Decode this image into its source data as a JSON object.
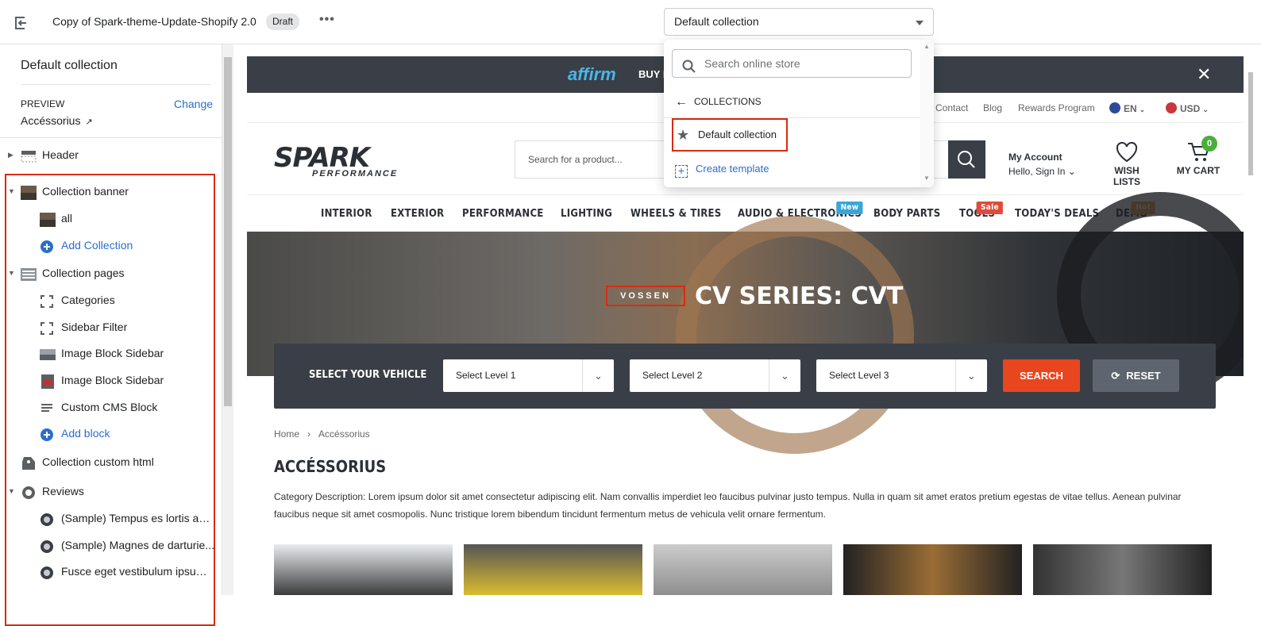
{
  "topbar": {
    "theme_name": "Copy of Spark-theme-Update-Shopify 2.0",
    "status_badge": "Draft",
    "more_label": "•••",
    "template_select": "Default collection"
  },
  "dropdown": {
    "search_placeholder": "Search online store",
    "back_label": "COLLECTIONS",
    "items": [
      "Default collection"
    ],
    "create_label": "Create template"
  },
  "sidebar": {
    "title": "Default collection",
    "preview_label": "PREVIEW",
    "change_label": "Change",
    "preview_value": "Accéssorius",
    "sections": [
      {
        "label": "Header"
      },
      {
        "label": "Collection banner",
        "blocks": [
          "all"
        ],
        "add_label": "Add Collection"
      },
      {
        "label": "Collection pages",
        "blocks": [
          "Categories",
          "Sidebar Filter",
          "Image Block Sidebar",
          "Image Block Sidebar",
          "Custom CMS Block"
        ],
        "add_label": "Add block"
      },
      {
        "label": "Collection custom html"
      },
      {
        "label": "Reviews",
        "blocks": [
          "(Sample) Tempus es lortis ado...",
          "(Sample) Magnes de darturie...",
          "Fusce eget vestibulum ipsumt..."
        ]
      }
    ]
  },
  "store": {
    "promo": {
      "brand": "affirm",
      "text": "BUY I",
      "close": "✕"
    },
    "utility": {
      "contact": "Contact",
      "blog": "Blog",
      "rewards": "Rewards Program",
      "lang": "EN",
      "currency": "USD"
    },
    "search_placeholder": "Search for a product...",
    "logo_main": "SPARK",
    "logo_sub": "PERFORMANCE",
    "account": {
      "title": "My Account",
      "sub": "Hello, Sign In"
    },
    "wishlist": "WISH LISTS",
    "cart": {
      "label": "MY CART",
      "count": "0"
    },
    "nav": [
      {
        "label": "INTERIOR"
      },
      {
        "label": "EXTERIOR"
      },
      {
        "label": "PERFORMANCE"
      },
      {
        "label": "LIGHTING"
      },
      {
        "label": "WHEELS & TIRES"
      },
      {
        "label": "AUDIO & ELECTRONICS",
        "tag": "New"
      },
      {
        "label": "BODY PARTS"
      },
      {
        "label": "TOOLS",
        "tag": "Sale"
      },
      {
        "label": "TODAY'S DEALS"
      },
      {
        "label": "DEMO",
        "tag": "Hot"
      }
    ],
    "tag_colors": {
      "New": "#3aa6d8",
      "Sale": "#e04a3a",
      "Hot": "#f0a93a"
    },
    "hero": {
      "brand": "VOSSEN",
      "title": "CV SERIES: CVT"
    },
    "vehicle": {
      "label": "SELECT YOUR VEHICLE",
      "selects": [
        "Select Level 1",
        "Select Level 2",
        "Select Level 3"
      ],
      "search": "SEARCH",
      "reset": "RESET"
    },
    "breadcrumb": {
      "home": "Home",
      "current": "Accéssorius"
    },
    "category_title": "ACCÉSSORIUS",
    "category_desc": "Category Description: Lorem ipsum dolor sit amet consectetur adipiscing elit. Nam convallis imperdiet leo faucibus pulvinar justo tempus. Nulla in quam sit amet eratos pretium egestas de vitae tellus. Aenean pulvinar faucibus neque sit amet cosmopolis. Nunc tristique lorem bibendum tincidunt fermentum metus de vehicula velit ornare fermentum."
  }
}
